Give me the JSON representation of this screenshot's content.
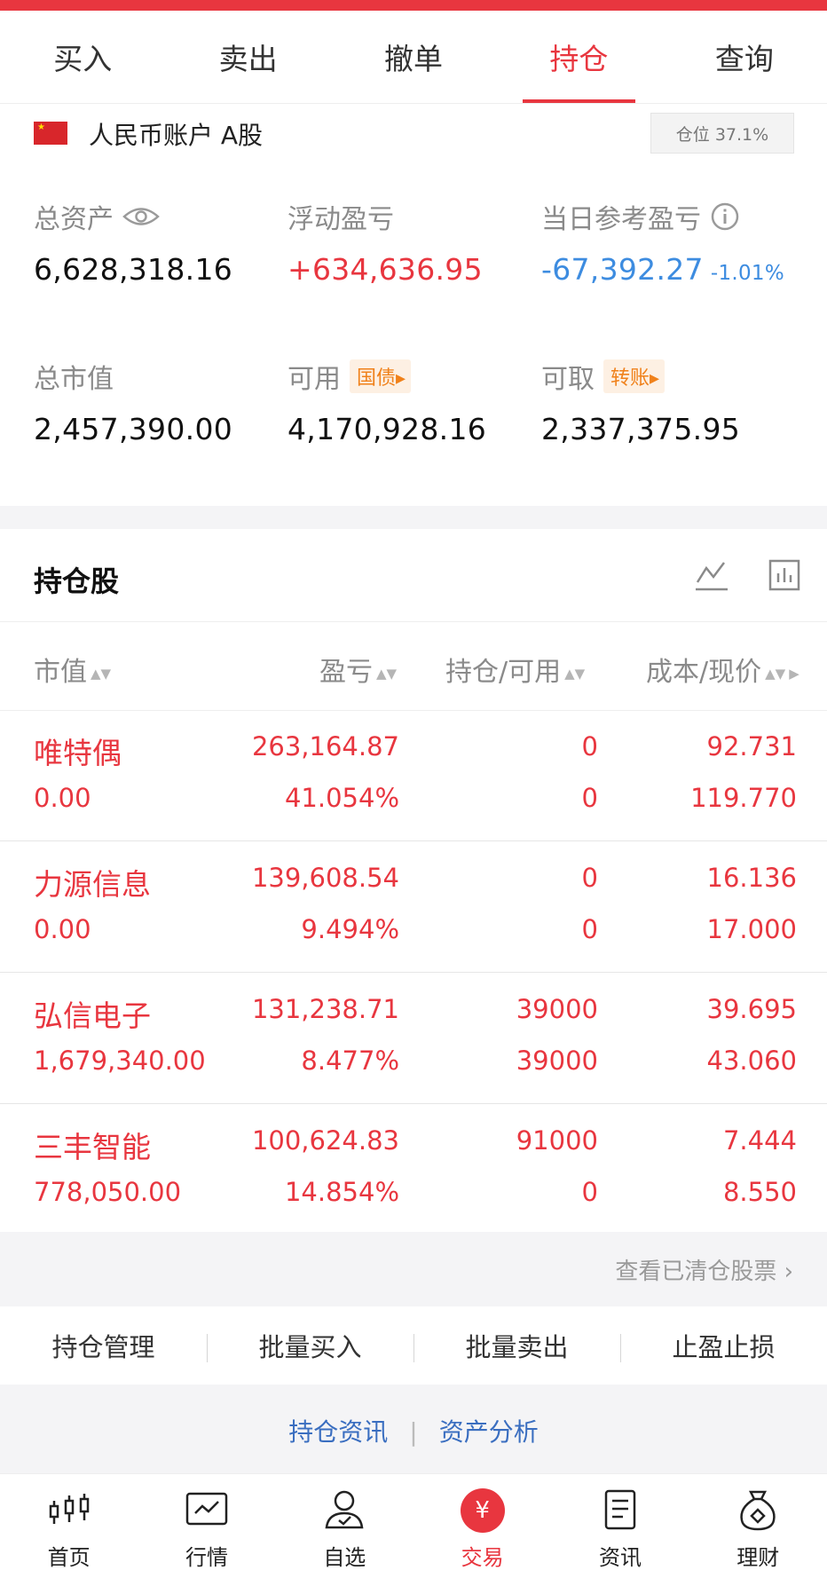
{
  "tabs": [
    {
      "label": "买入"
    },
    {
      "label": "卖出"
    },
    {
      "label": "撤单"
    },
    {
      "label": "持仓",
      "active": true
    },
    {
      "label": "查询"
    }
  ],
  "account": {
    "name": "人民币账户 A股",
    "position_badge": "仓位 37.1%"
  },
  "stats": {
    "total_assets": {
      "label": "总资产",
      "value": "6,628,318.16"
    },
    "floating_pl": {
      "label": "浮动盈亏",
      "value": "+634,636.95"
    },
    "daily_pl": {
      "label": "当日参考盈亏",
      "value": "-67,392.27",
      "pct": "-1.01%"
    },
    "market_value": {
      "label": "总市值",
      "value": "2,457,390.00"
    },
    "available": {
      "label": "可用",
      "chip": "国债",
      "value": "4,170,928.16"
    },
    "withdrawable": {
      "label": "可取",
      "chip": "转账",
      "value": "2,337,375.95"
    }
  },
  "holdings": {
    "title": "持仓股",
    "columns": [
      "市值",
      "盈亏",
      "持仓/可用",
      "成本/现价"
    ],
    "rows": [
      {
        "name": "唯特偶",
        "market_value": "0.00",
        "pl": "263,164.87",
        "pl_pct": "41.054%",
        "hold": "0",
        "avail": "0",
        "cost": "92.731",
        "price": "119.770"
      },
      {
        "name": "力源信息",
        "market_value": "0.00",
        "pl": "139,608.54",
        "pl_pct": "9.494%",
        "hold": "0",
        "avail": "0",
        "cost": "16.136",
        "price": "17.000"
      },
      {
        "name": "弘信电子",
        "market_value": "1,679,340.00",
        "pl": "131,238.71",
        "pl_pct": "8.477%",
        "hold": "39000",
        "avail": "39000",
        "cost": "39.695",
        "price": "43.060"
      },
      {
        "name": "三丰智能",
        "market_value": "778,050.00",
        "pl": "100,624.83",
        "pl_pct": "14.854%",
        "hold": "91000",
        "avail": "0",
        "cost": "7.444",
        "price": "8.550"
      }
    ],
    "cleared_link": "查看已清仓股票"
  },
  "actions": [
    "持仓管理",
    "批量买入",
    "批量卖出",
    "止盈止损"
  ],
  "links": [
    "持仓资讯",
    "资产分析"
  ],
  "nav": [
    {
      "label": "首页",
      "icon": "candlestick-icon"
    },
    {
      "label": "行情",
      "icon": "chart-line-icon"
    },
    {
      "label": "自选",
      "icon": "user-check-icon"
    },
    {
      "label": "交易",
      "icon": "yen-icon",
      "symbol": "¥",
      "active": true
    },
    {
      "label": "资讯",
      "icon": "document-icon"
    },
    {
      "label": "理财",
      "icon": "money-bag-icon"
    }
  ],
  "colors": {
    "accent": "#e8363f",
    "negative": "#3d8ce0",
    "chip": "#f0811a"
  }
}
